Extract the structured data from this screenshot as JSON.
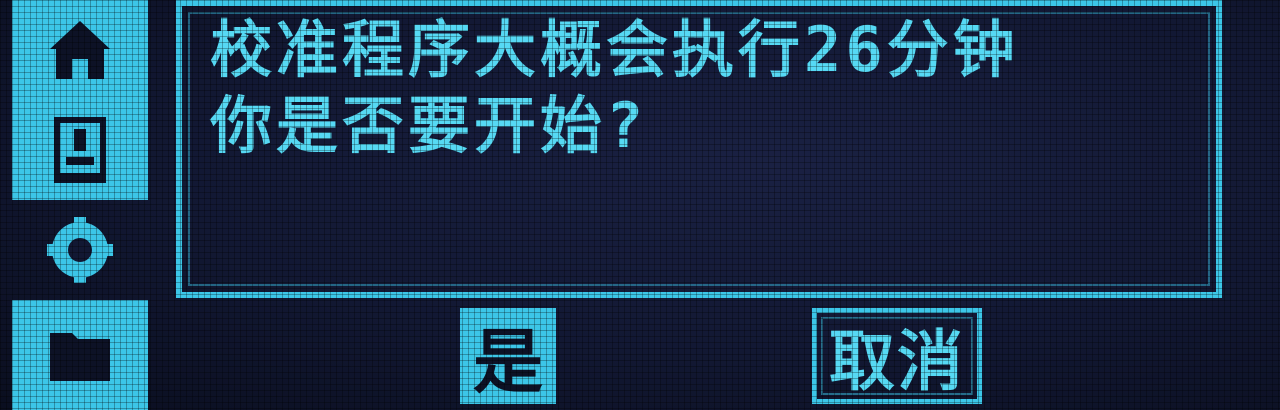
{
  "sidebar": {
    "items": [
      {
        "icon": "home-icon",
        "active": true
      },
      {
        "icon": "device-icon",
        "active": true
      },
      {
        "icon": "settings-icon",
        "active": false
      },
      {
        "icon": "folder-icon",
        "active": true
      }
    ]
  },
  "dialog": {
    "line1": "校准程序大概会执行26分钟",
    "line2": "你是否要开始?"
  },
  "buttons": {
    "yes_label": "是",
    "cancel_label": "取消"
  },
  "colors": {
    "accent": "#3cc6e8",
    "background": "#121833",
    "text": "#56d9f4"
  }
}
